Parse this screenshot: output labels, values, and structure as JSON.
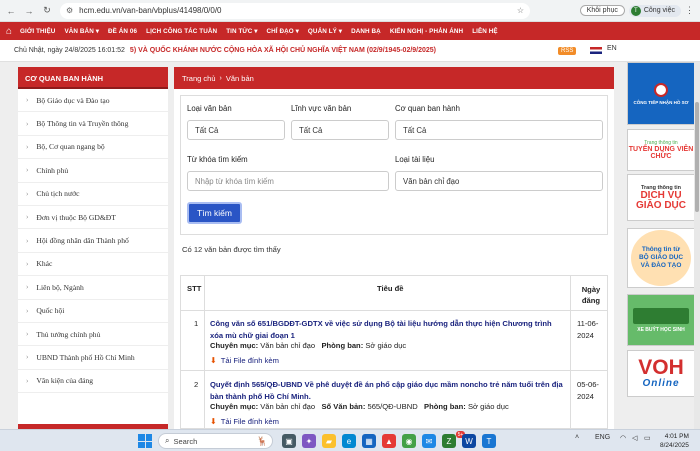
{
  "browser": {
    "url": "hcm.edu.vn/van-ban/vbplus/41498/0/0/0",
    "restore_label": "Khôi phục",
    "profile_initial": "T",
    "profile_label": "Công việc"
  },
  "topnav": {
    "items": [
      "GIỚI THIỆU",
      "VĂN BẢN ▾",
      "ĐỀ ÁN 06",
      "LỊCH CÔNG TÁC TUẦN",
      "TIN TỨC ▾",
      "CHỈ ĐẠO ▾",
      "QUẢN LÝ ▾",
      "DANH BẠ",
      "KIẾN NGHỊ - PHẢN ÁNH",
      "LIÊN HỆ"
    ]
  },
  "datebar": {
    "date": "Chủ Nhật, ngày 24/8/2025 16:01:52",
    "marquee": "5) VÀ QUỐC KHÁNH NƯỚC CỘNG HÒA XÃ HỘI CHỦ NGHĨA VIỆT NAM (02/9/1945-02/9/2025)",
    "rss": "RSS",
    "lang": "EN"
  },
  "sidebar": {
    "title": "CƠ QUAN BAN HÀNH",
    "items": [
      "Bộ Giáo dục và Đào tạo",
      "Bộ Thông tin và Truyền thông",
      "Bộ, Cơ quan ngang bộ",
      "Chính phủ",
      "Chủ tịch nước",
      "Đơn vị thuộc Bộ GD&ĐT",
      "Hội đồng nhân dân Thành phố",
      "Khác",
      "Liên bộ, Ngành",
      "Quốc hội",
      "Thủ tướng chính phủ",
      "UBND Thành phố Hồ Chí Minh",
      "Văn kiện của đảng"
    ]
  },
  "breadcrumb": {
    "home": "Trang chủ",
    "current": "Văn bản"
  },
  "search": {
    "loai_label": "Loại văn bản",
    "loai_value": "Tất Cả",
    "linhvuc_label": "Lĩnh vực văn bản",
    "linhvuc_value": "Tất Cả",
    "coquan_label": "Cơ quan ban hành",
    "coquan_value": "Tất Cả",
    "keyword_label": "Từ khóa tìm kiếm",
    "keyword_placeholder": "Nhập từ khóa tìm kiếm",
    "tailieu_label": "Loại tài liệu",
    "tailieu_value": "Văn bản chỉ đạo",
    "button": "Tìm kiếm"
  },
  "result_count": "Có 12 văn bản được tìm thấy",
  "table": {
    "headers": {
      "stt": "STT",
      "title": "Tiêu đề",
      "date_line1": "Ngày",
      "date_line2": "đăng"
    },
    "rows": [
      {
        "stt": "1",
        "title": "Công văn số 651/BGDĐT-GDTX về việc sử dụng Bộ tài liệu hướng dẫn thực hiện Chương trình xóa mù chữ giai đoạn 1",
        "chuyenmuc_label": "Chuyên mục:",
        "chuyenmuc": "Văn bản chỉ đạo",
        "phongban_label": "Phòng ban:",
        "phongban": "Sở giáo dục",
        "download": "Tải File đính kèm",
        "date_line1": "11-06-",
        "date_line2": "2024"
      },
      {
        "stt": "2",
        "title": "Quyết định 565/QĐ-UBND Về phê duyệt đề án phổ cập giáo dục mầm noncho trẻ năm tuổi trên địa bàn thành phố Hồ Chí Minh.",
        "chuyenmuc_label": "Chuyên mục:",
        "chuyenmuc": "Văn bản chỉ đạo",
        "sovanban_label": "Số Văn bản:",
        "sovanban": "565/QĐ-UBND",
        "phongban_label": "Phòng ban:",
        "phongban": "Sở giáo dục",
        "download": "Tải File đính kèm",
        "date_line1": "05-06-",
        "date_line2": "2024"
      }
    ]
  },
  "banners": {
    "b1": "CÔNG TIẾP NHẬN HỒ SƠ",
    "b2_small": "Trang thông tin",
    "b2_big": "TUYỂN DỤNG VIÊN CHỨC",
    "b3_small": "Trang thông tin",
    "b3_big": "DỊCH VỤ GIÁO DỤC",
    "b4_l1": "Thông tin từ",
    "b4_l2": "BỘ GIÁO DỤC",
    "b4_l3": "VÀ ĐÀO TẠO",
    "b5": "XE BUÝT HỌC SINH",
    "b6_big": "VOH",
    "b6_small": "Online"
  },
  "taskbar": {
    "search": "Search",
    "lang": "ENG",
    "time": "4:01 PM",
    "date": "8/24/2025",
    "notif_badge": "5+"
  },
  "colors": {
    "brand_red": "#c62828",
    "button_blue": "#2a55c5",
    "link_navy": "#1a237e"
  }
}
